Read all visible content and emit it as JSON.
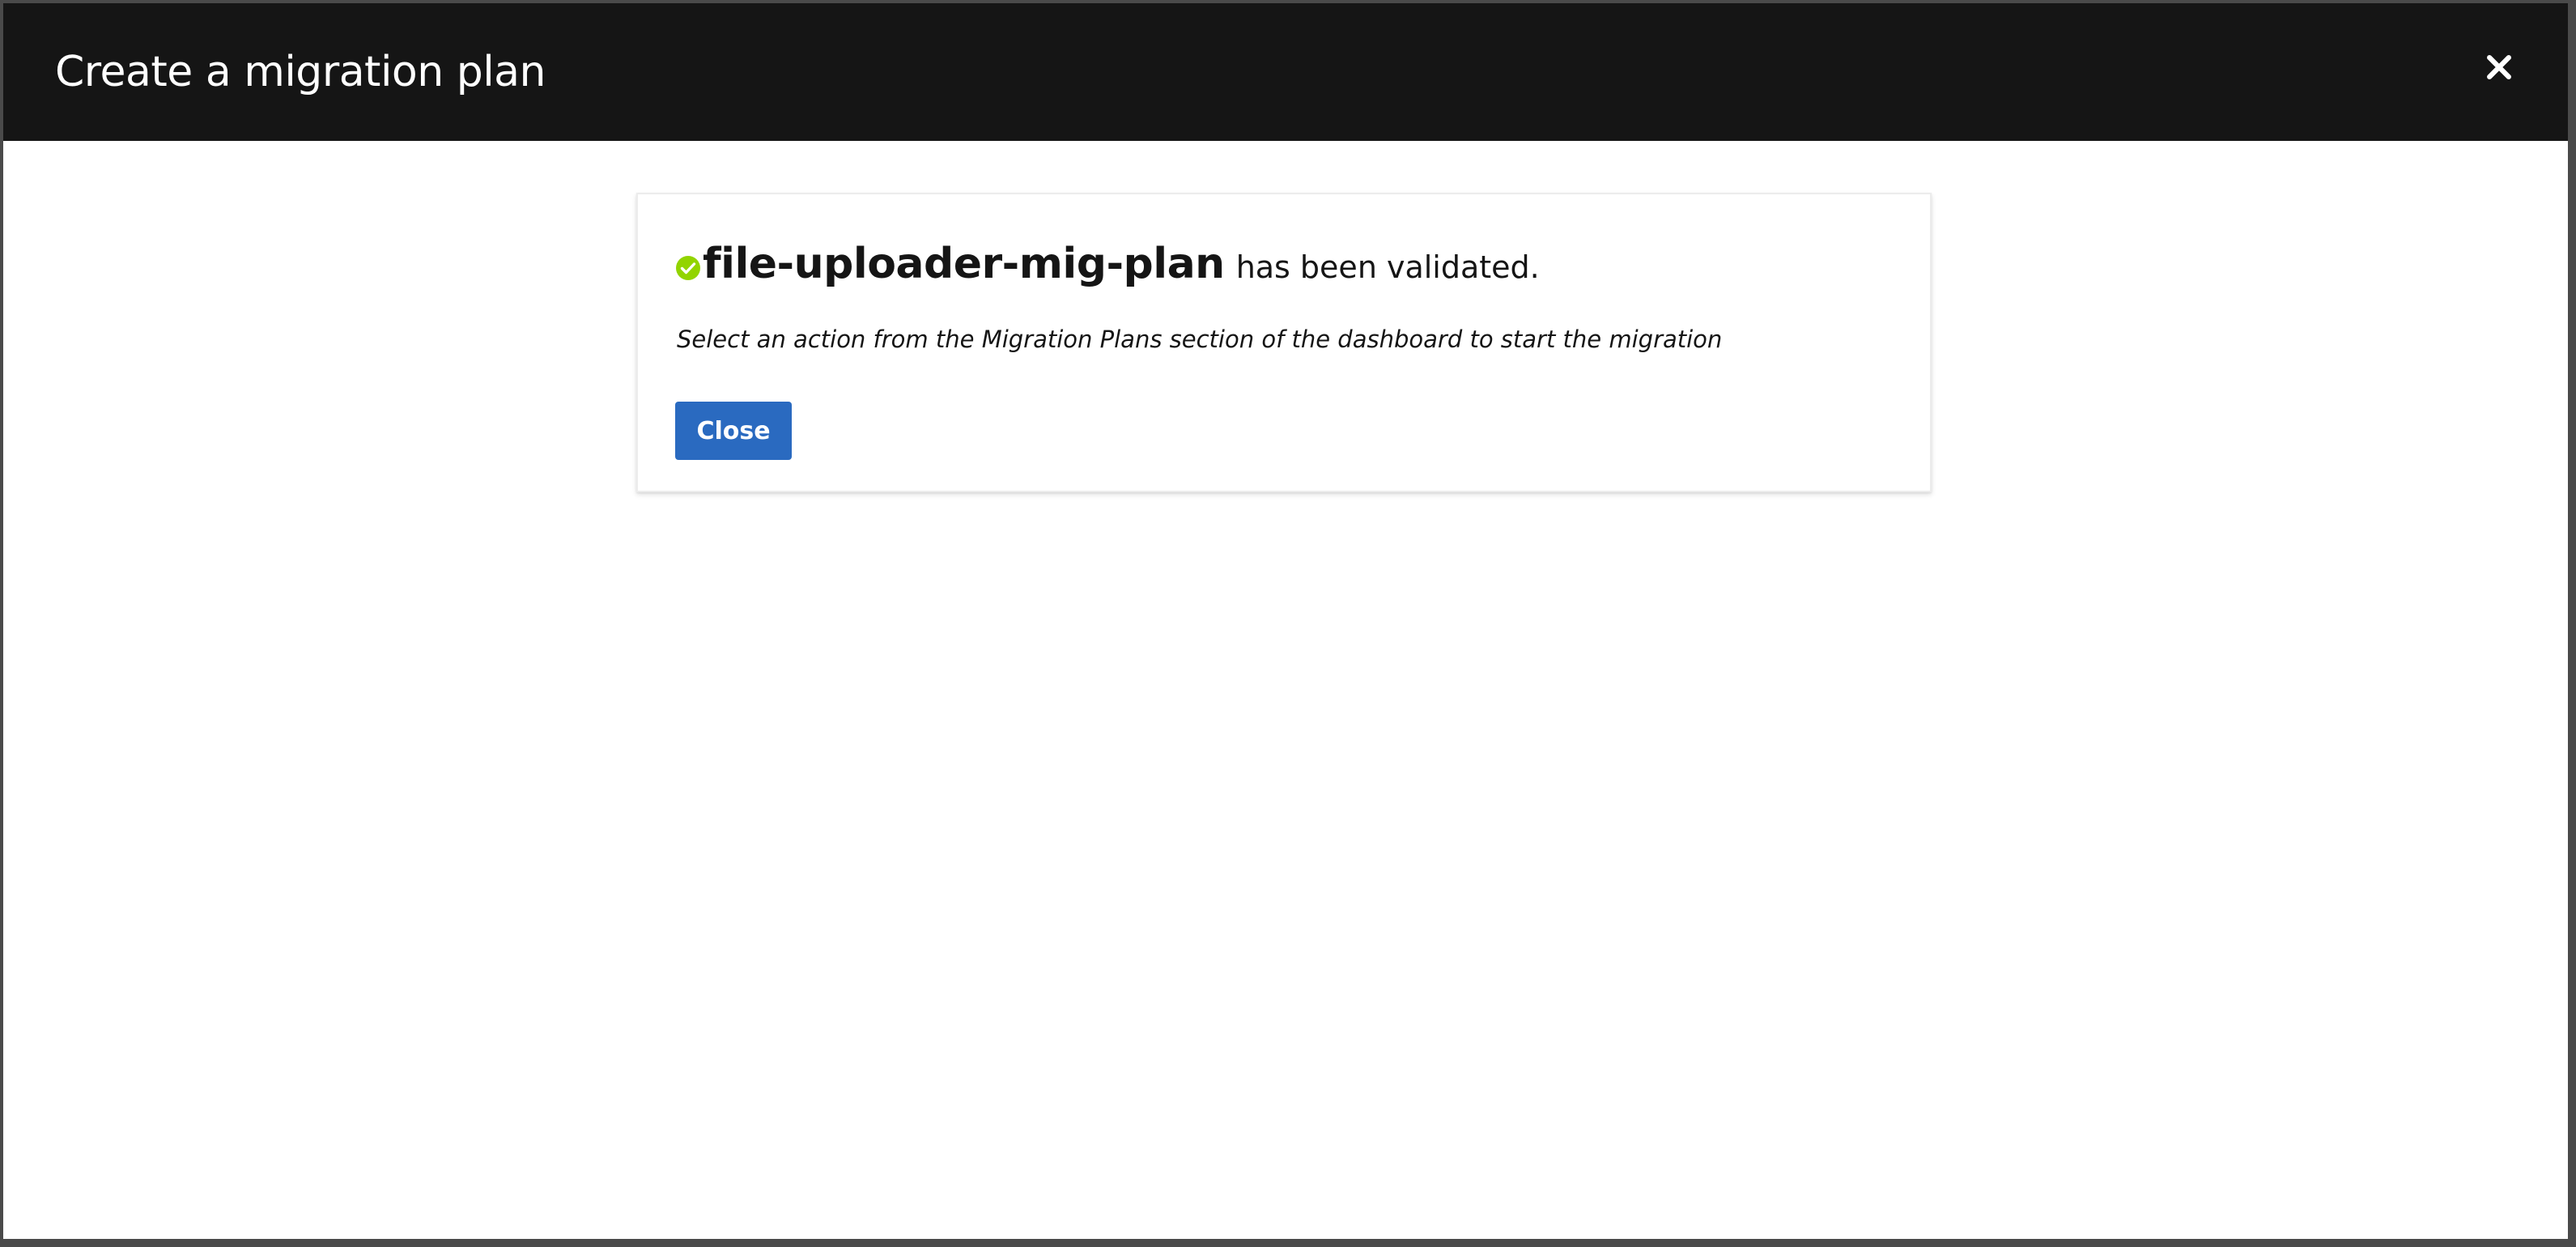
{
  "modal": {
    "title": "Create a migration plan",
    "close_icon": "close-icon"
  },
  "result": {
    "status_icon": "check-circle-icon",
    "status_color": "#92d400",
    "plan_name": "file-uploader-mig-plan",
    "status_text": "has been validated.",
    "instruction": "Select an action from the Migration Plans section of the dashboard to start the migration",
    "close_button_label": "Close",
    "button_color": "#2a6ac0"
  }
}
